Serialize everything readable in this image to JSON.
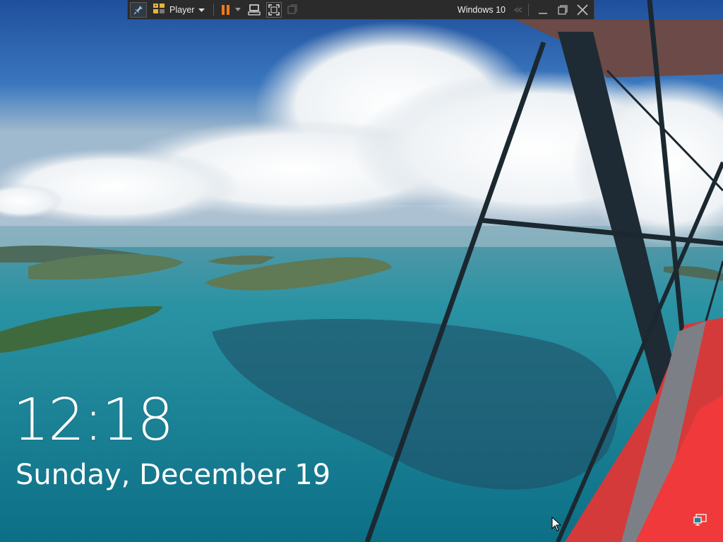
{
  "vm_toolbar": {
    "pin_icon": "pin-icon",
    "player_label": "Player",
    "player_icon": "vmware-player-icon",
    "pause_icon": "pause-icon",
    "send_keys_icon": "send-ctrl-alt-del-icon",
    "fullscreen_icon": "fullscreen-icon",
    "unity_icon": "unity-icon",
    "vm_name": "Windows 10",
    "minimize_icon": "minimize-icon",
    "restore_icon": "restore-icon",
    "close_icon": "close-icon"
  },
  "lock_screen": {
    "time": "12:18",
    "date": "Sunday, December 19",
    "network_icon": "network-icon"
  },
  "colors": {
    "pause_orange": "#f07a1a",
    "toolbar_bg": "#2b2b2b"
  }
}
